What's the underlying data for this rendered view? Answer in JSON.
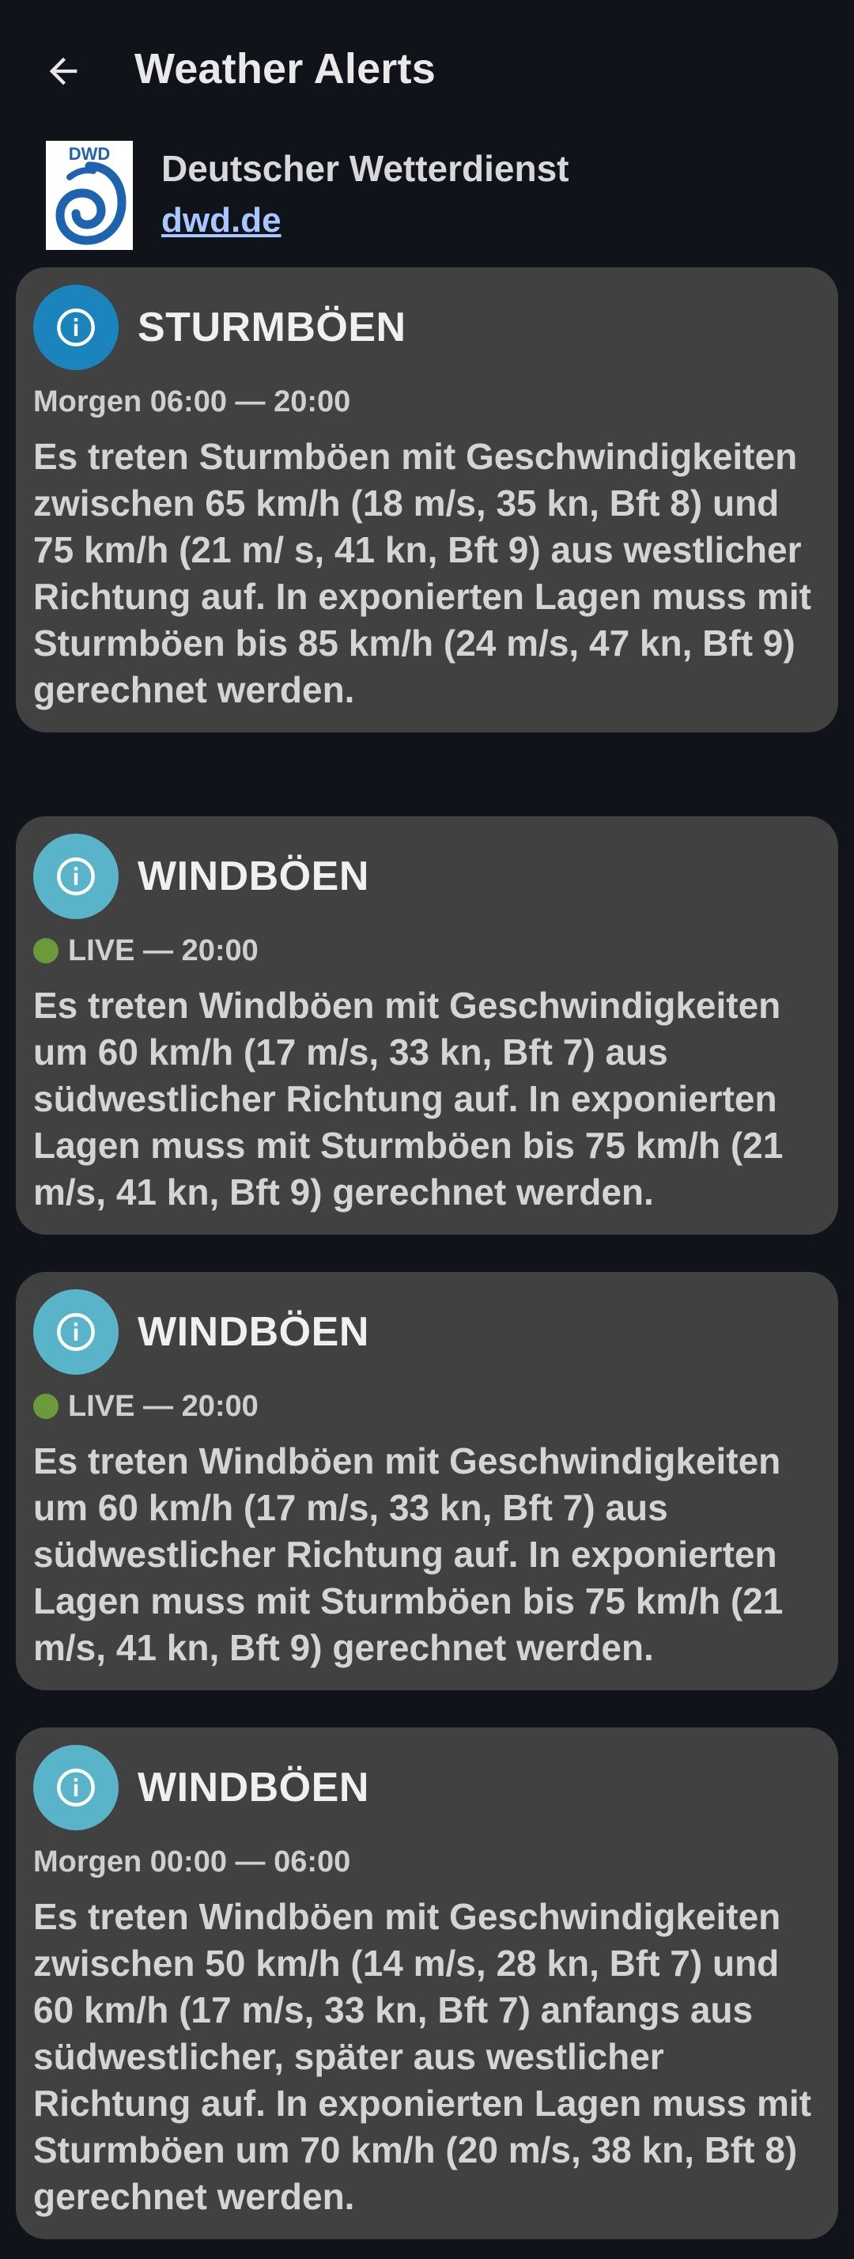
{
  "header": {
    "title": "Weather Alerts"
  },
  "source": {
    "name": "Deutscher Wetterdienst",
    "link": "dwd.de",
    "logo_text": "DWD"
  },
  "colors": {
    "background": "#10131a",
    "card": "#414141",
    "info_strong": "#1b84bd",
    "info_light": "#5ab4c9",
    "live_dot": "#6a9a3a",
    "link": "#a8c6ff",
    "logo_blue": "#1e63b0"
  },
  "alerts": [
    {
      "title": "STURMBÖEN",
      "icon": "info-icon",
      "time": "Morgen 06:00 — 20:00",
      "live": false,
      "text": "Es treten Sturmböen mit Geschwindigkeiten zwischen 65 km/h (18 m/s, 35 kn, Bft 8) und 75 km/h (21 m/ s, 41 kn, Bft 9) aus westlicher Richtung auf. In exponierten Lagen muss mit Sturmböen bis 85 km/h (24 m/s, 47 kn, Bft 9) gerechnet werden."
    },
    {
      "title": "WINDBÖEN",
      "icon": "info-icon",
      "time": "LIVE — 20:00",
      "live": true,
      "text": "Es treten Windböen mit Geschwindigkeiten um 60 km/h (17 m/s, 33 kn, Bft 7) aus südwestlicher Richtung auf. In exponierten Lagen muss mit Sturmböen bis 75 km/h (21 m/s, 41 kn, Bft 9) gerechnet werden."
    },
    {
      "title": "WINDBÖEN",
      "icon": "info-icon",
      "time": "LIVE — 20:00",
      "live": true,
      "text": "Es treten Windböen mit Geschwindigkeiten um 60 km/h (17 m/s, 33 kn, Bft 7) aus südwestlicher Richtung auf. In exponierten Lagen muss mit Sturmböen bis 75 km/h (21 m/s, 41 kn, Bft 9) gerechnet werden."
    },
    {
      "title": "WINDBÖEN",
      "icon": "info-icon",
      "time": "Morgen 00:00 — 06:00",
      "live": false,
      "text": "Es treten Windböen mit Geschwindigkeiten zwischen 50 km/h (14 m/s, 28 kn, Bft 7) und 60 km/h (17 m/s, 33 kn, Bft 7) anfangs aus südwestlicher, später aus westlicher Richtung auf. In exponierten Lagen muss mit Sturmböen um 70 km/h (20 m/s, 38 kn, Bft 8) gerechnet werden."
    }
  ]
}
